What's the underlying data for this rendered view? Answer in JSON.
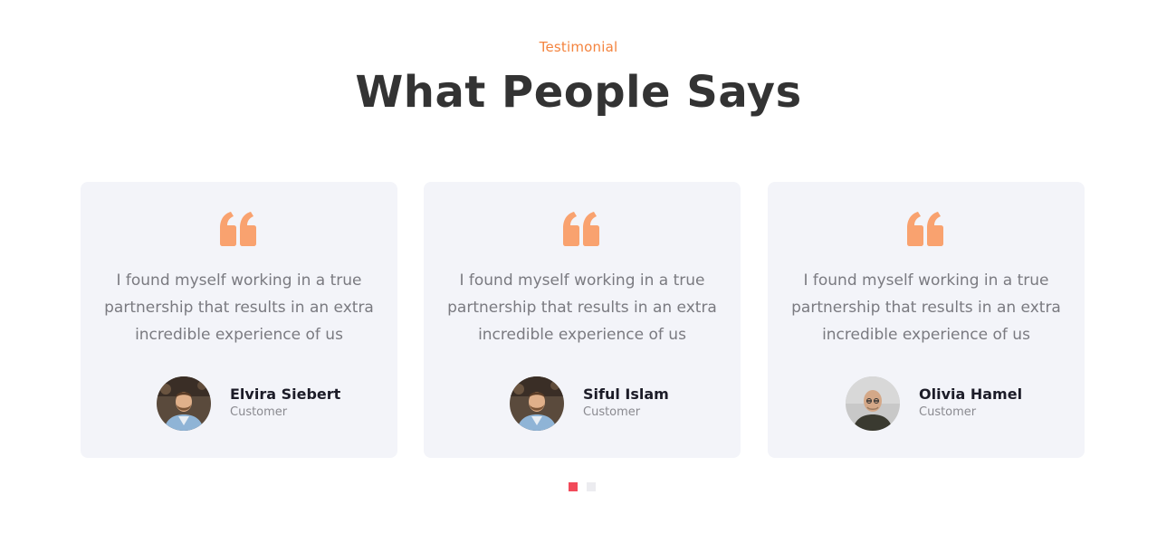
{
  "section": {
    "eyebrow": "Testimonial",
    "heading": "What People Says"
  },
  "colors": {
    "accent": "#f4843f",
    "quote_icon": "#f9a26f",
    "card_bg": "#f3f4f9",
    "dot_active": "#f24a5a",
    "dot_inactive": "#ececf0"
  },
  "testimonials": [
    {
      "quote": "I found myself working in a true partnership that results in an extra incredible experience of us",
      "name": "Elvira Siebert",
      "role": "Customer",
      "avatar_icon": "bearded-man-avatar"
    },
    {
      "quote": "I found myself working in a true partnership that results in an extra incredible experience of us",
      "name": "Siful Islam",
      "role": "Customer",
      "avatar_icon": "bearded-man-avatar"
    },
    {
      "quote": "I found myself working in a true partnership that results in an extra incredible experience of us",
      "name": "Olivia Hamel",
      "role": "Customer",
      "avatar_icon": "bald-man-avatar"
    }
  ],
  "pagination": {
    "total": 2,
    "active": 1
  }
}
